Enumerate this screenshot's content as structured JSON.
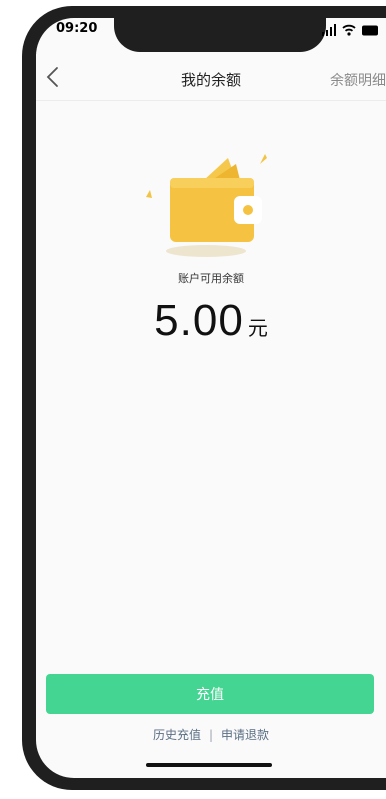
{
  "status_bar": {
    "time": "09:20",
    "icons": [
      "signal-icon",
      "wifi-icon",
      "battery-icon"
    ]
  },
  "nav": {
    "back_icon": "chevron-left-icon",
    "title": "我的余额",
    "action": "余额明细"
  },
  "balance": {
    "label": "账户可用余额",
    "amount": "5.00",
    "unit": "元"
  },
  "buttons": {
    "recharge": "充值"
  },
  "links": {
    "history": "历史充值",
    "separator": "|",
    "refund": "申请退款"
  },
  "colors": {
    "accent_green": "#43d591",
    "wallet_yellow": "#f5c242",
    "link_color": "#5b6f84"
  }
}
